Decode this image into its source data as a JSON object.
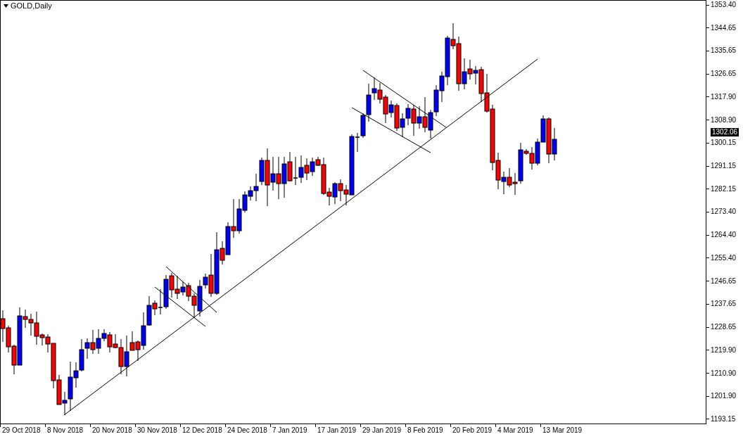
{
  "chart": {
    "title": "GOLD,Daily",
    "current_price": "1302.06",
    "price_axis": [
      "1353.40",
      "1344.65",
      "1335.65",
      "1326.65",
      "1317.90",
      "1308.90",
      "1300.15",
      "1291.15",
      "1282.15",
      "1273.40",
      "1264.40",
      "1255.40",
      "1246.65",
      "1237.65",
      "1228.65",
      "1219.90",
      "1210.90",
      "1201.90",
      "1193.15"
    ],
    "time_axis": [
      "29 Oct 2018",
      "8 Nov 2018",
      "20 Nov 2018",
      "30 Nov 2018",
      "12 Dec 2018",
      "24 Dec 2018",
      "7 Jan 2019",
      "17 Jan 2019",
      "29 Jan 2019",
      "8 Feb 2019",
      "20 Feb 2019",
      "4 Mar 2019",
      "13 Mar 2019"
    ]
  }
}
